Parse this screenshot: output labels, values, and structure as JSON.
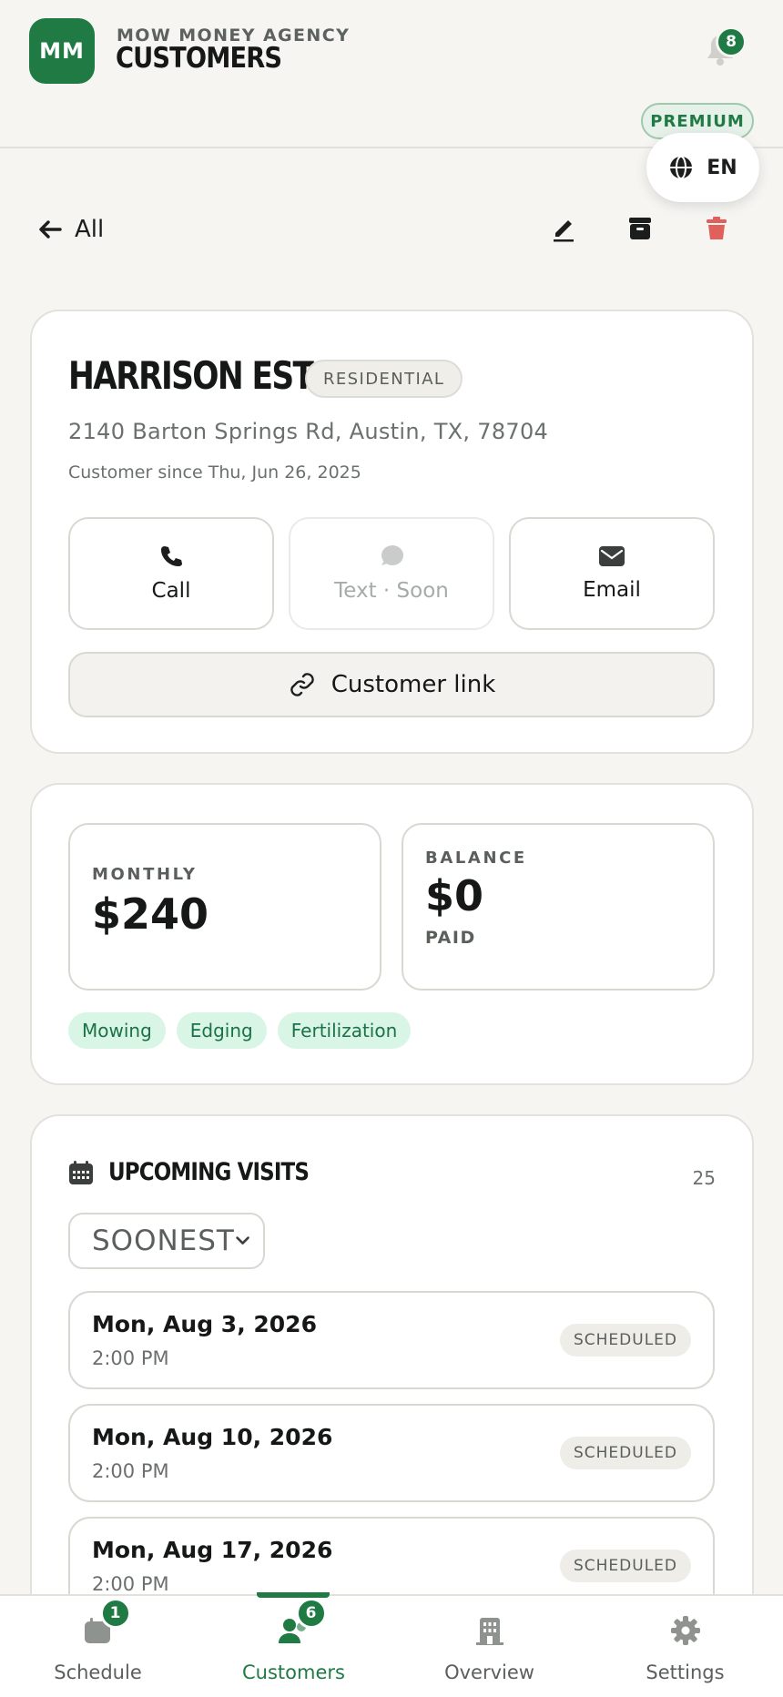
{
  "header": {
    "logo_initials": "MM",
    "agency_name": "MOW MONEY AGENCY",
    "page_title": "CUSTOMERS",
    "notification_count": "8",
    "plan_badge": "PREMIUM",
    "language": "EN"
  },
  "toolbar": {
    "back_label": "All",
    "edit_icon": "pencil-icon",
    "archive_icon": "archive-icon",
    "delete_icon": "trash-icon"
  },
  "customer": {
    "name": "HARRISON ESTATE",
    "type": "RESIDENTIAL",
    "address": "2140 Barton Springs Rd, Austin, TX, 78704",
    "since": "Customer since Thu, Jun 26, 2025",
    "actions": {
      "call": "Call",
      "text": "Text · Soon",
      "email": "Email",
      "customer_link": "Customer link"
    }
  },
  "billing": {
    "monthly_label": "MONTHLY",
    "monthly_value": "$240",
    "balance_label": "BALANCE",
    "balance_value": "$0",
    "balance_status": "PAID",
    "services": [
      "Mowing",
      "Edging",
      "Fertilization"
    ]
  },
  "visits": {
    "title": "UPCOMING VISITS",
    "count": "25",
    "sort": "SOONEST",
    "items": [
      {
        "date": "Mon, Aug 3, 2026",
        "time": "2:00 PM",
        "status": "SCHEDULED"
      },
      {
        "date": "Mon, Aug 10, 2026",
        "time": "2:00 PM",
        "status": "SCHEDULED"
      },
      {
        "date": "Mon, Aug 17, 2026",
        "time": "2:00 PM",
        "status": "SCHEDULED"
      }
    ]
  },
  "nav": {
    "items": [
      {
        "label": "Schedule",
        "badge": "1",
        "icon": "calendar-icon"
      },
      {
        "label": "Customers",
        "badge": "6",
        "icon": "users-icon"
      },
      {
        "label": "Overview",
        "icon": "building-icon"
      },
      {
        "label": "Settings",
        "icon": "gear-icon"
      }
    ]
  },
  "colors": {
    "brand": "#1f7a43",
    "danger": "#e0605c",
    "tag_bg": "#d9f5e5",
    "background": "#f6f5f2"
  }
}
